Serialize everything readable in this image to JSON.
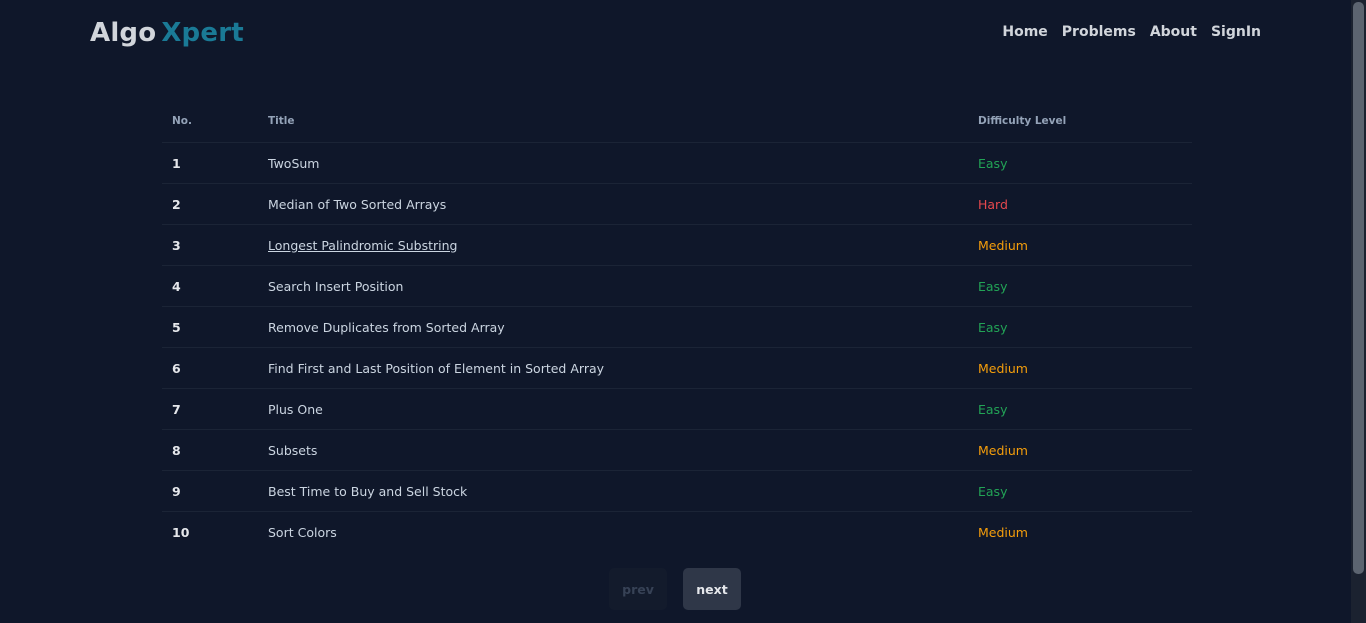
{
  "brand": {
    "part1": "Algo",
    "part2": "Xpert"
  },
  "nav": {
    "home": "Home",
    "problems": "Problems",
    "about": "About",
    "signin": "SignIn"
  },
  "table": {
    "headers": {
      "no": "No.",
      "title": "Title",
      "difficulty": "Difficulty Level"
    },
    "rows": [
      {
        "no": "1",
        "title": "TwoSum",
        "difficulty": "Easy"
      },
      {
        "no": "2",
        "title": "Median of Two Sorted Arrays",
        "difficulty": "Hard"
      },
      {
        "no": "3",
        "title": "Longest Palindromic Substring",
        "difficulty": "Medium"
      },
      {
        "no": "4",
        "title": "Search Insert Position",
        "difficulty": "Easy"
      },
      {
        "no": "5",
        "title": "Remove Duplicates from Sorted Array",
        "difficulty": "Easy"
      },
      {
        "no": "6",
        "title": "Find First and Last Position of Element in Sorted Array",
        "difficulty": "Medium"
      },
      {
        "no": "7",
        "title": "Plus One",
        "difficulty": "Easy"
      },
      {
        "no": "8",
        "title": "Subsets",
        "difficulty": "Medium"
      },
      {
        "no": "9",
        "title": "Best Time to Buy and Sell Stock",
        "difficulty": "Easy"
      },
      {
        "no": "10",
        "title": "Sort Colors",
        "difficulty": "Medium"
      }
    ]
  },
  "pagination": {
    "prev": "prev",
    "next": "next"
  },
  "colors": {
    "easy": "#22a356",
    "hard": "#e5484d",
    "medium": "#f59e0b",
    "brand_accent": "#1a7a96",
    "background": "#0f172a"
  }
}
